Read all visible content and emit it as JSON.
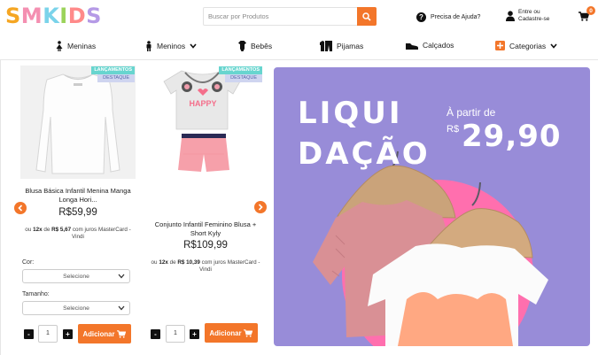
{
  "header": {
    "logo_letters": [
      "S",
      "M",
      "K",
      "I",
      "D",
      "S"
    ],
    "logo_colors": [
      "#f5a623",
      "#f48fb1",
      "#7ad3ea",
      "#9bd35a",
      "#ff8a8a",
      "#b59ae6"
    ],
    "search_placeholder": "Buscar por Produtos",
    "help_label": "Precisa de Ajuda?",
    "account_line1": "Entre ou",
    "account_line2": "Cadastre-se",
    "cart_count": "0"
  },
  "nav": {
    "items": [
      {
        "label": "Meninas",
        "icon": "girl-icon"
      },
      {
        "label": "Meninos",
        "icon": "boy-icon",
        "dropdown": true
      },
      {
        "label": "Bebês",
        "icon": "baby-bodysuit-icon"
      },
      {
        "label": "Pijamas",
        "icon": "pajama-icon"
      },
      {
        "label": "Calçados",
        "icon": "shoe-icon"
      },
      {
        "label": "Categorias",
        "icon": "plus-square-icon",
        "dropdown": true
      }
    ]
  },
  "products": [
    {
      "badge_new": "LANÇAMENTOS",
      "badge_featured": "DESTAQUE",
      "name": "Blusa Básica Infantil Menina Manga Longa Hori...",
      "price": "R$59,99",
      "installment_prefix": "ou",
      "installment_bold": "12x",
      "installment_mid": "de",
      "installment_value": "R$ 5,67",
      "installment_suffix": "com juros MasterCard - Vindi",
      "color_label": "Cor:",
      "color_value": "Selecione",
      "size_label": "Tamanho:",
      "size_value": "Selecione",
      "qty": "1",
      "add_label": "Adicionar"
    },
    {
      "badge_new": "LANÇAMENTOS",
      "badge_featured": "DESTAQUE",
      "name": "Conjunto Infantil Feminino Blusa + Short Kyly",
      "price": "R$109,99",
      "installment_prefix": "ou",
      "installment_bold": "12x",
      "installment_mid": "de",
      "installment_value": "R$ 10,39",
      "installment_suffix": "com juros MasterCard - Vindi",
      "tee_text": "HAPPY",
      "qty": "1",
      "add_label": "Adicionar"
    }
  ],
  "banner": {
    "line1": "LIQUI",
    "line2": "DAÇÃO",
    "from_label": "À partir de",
    "currency": "R$",
    "price": "29,90",
    "bg_color": "#988cd8"
  },
  "colors": {
    "accent": "#f3762a",
    "badge_new": "#68d5cf",
    "badge_featured": "#cfd5f0"
  }
}
